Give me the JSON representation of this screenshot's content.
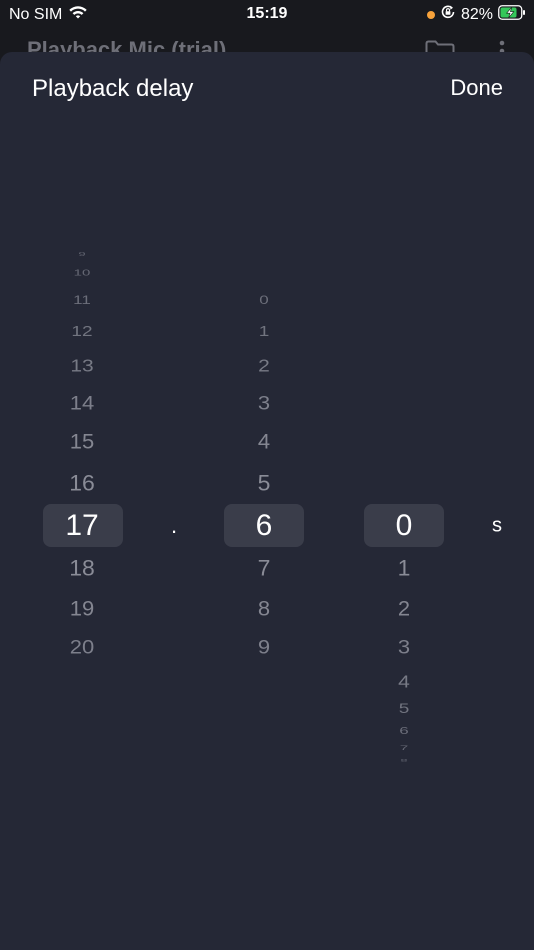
{
  "status_bar": {
    "carrier": "No SIM",
    "time": "15:19",
    "battery_percent": "82%",
    "wifi_icon": "wifi-icon",
    "orientation_lock_icon": "orientation-lock-icon",
    "battery_icon": "battery-charging-icon",
    "recording_dot_color": "#f7a23b",
    "battery_level": 0.82
  },
  "app_header": {
    "title": "Playback Mic (trial)",
    "folder_icon": "folder-icon",
    "more_icon": "more-vertical-icon"
  },
  "sheet": {
    "title": "Playback delay",
    "done_label": "Done"
  },
  "picker": {
    "unit": "s",
    "separator": ".",
    "columns": [
      {
        "name": "whole-seconds",
        "selected": "17",
        "above": [
          "9",
          "10",
          "11",
          "12",
          "13",
          "14",
          "15",
          "16"
        ],
        "below": [
          "18",
          "19",
          "20"
        ]
      },
      {
        "name": "tenths",
        "selected": "6",
        "above": [
          "0",
          "1",
          "2",
          "3",
          "4",
          "5"
        ],
        "below": [
          "7",
          "8",
          "9"
        ]
      },
      {
        "name": "hundredths",
        "selected": "0",
        "above": [],
        "below": [
          "1",
          "2",
          "3",
          "4",
          "5",
          "6",
          "7",
          "8"
        ]
      }
    ]
  },
  "colors": {
    "sheet_background": "#252836",
    "selection_band": "#3a3d4a",
    "item_text": "#8a8c97",
    "selected_text": "#ffffff"
  }
}
